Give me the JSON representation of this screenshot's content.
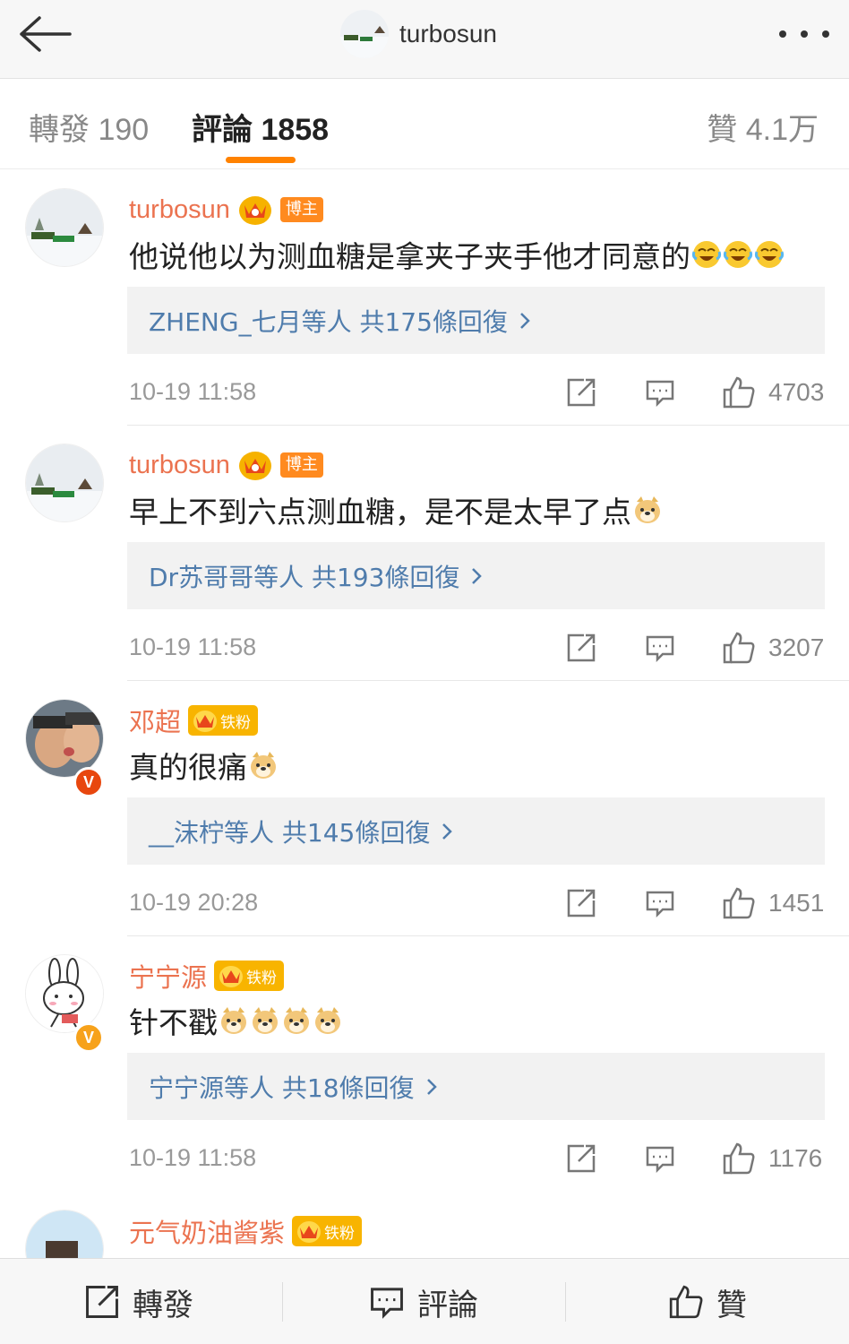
{
  "header": {
    "title": "turbosun",
    "back_icon": "arrow-left-icon",
    "more_icon": "more-dots-icon"
  },
  "tabs": {
    "repost": "轉發 190",
    "comments": "評論 1858",
    "likes": "贊 4.1万",
    "active": "comments",
    "accent_color": "#ff8200"
  },
  "comments": [
    {
      "username": "turbosun",
      "badge": "博主",
      "text": "他说他以为测血糖是拿夹子夹手他才同意的",
      "emoji": [
        "laugh-cry-emoji",
        "laugh-cry-emoji",
        "laugh-cry-emoji"
      ],
      "reply_summary": "ZHENG_七月等人 共175條回復",
      "time": "10-19 11:58",
      "likes": "4703"
    },
    {
      "username": "turbosun",
      "badge": "博主",
      "text": "早上不到六点测血糖，是不是太早了点",
      "emoji": [
        "doge-emoji"
      ],
      "reply_summary": "Dr苏哥哥等人 共193條回復",
      "time": "10-19 11:58",
      "likes": "3207"
    },
    {
      "username": "邓超",
      "badge": "铁粉",
      "text": "真的很痛",
      "emoji": [
        "doge-emoji"
      ],
      "reply_summary": "__沫柠等人 共145條回復",
      "time": "10-19 20:28",
      "likes": "1451"
    },
    {
      "username": "宁宁源",
      "badge": "铁粉",
      "text": "针不戳",
      "emoji": [
        "doge-emoji",
        "doge-emoji",
        "doge-emoji",
        "doge-emoji"
      ],
      "reply_summary": "宁宁源等人 共18條回復",
      "time": "10-19 11:58",
      "likes": "1176"
    },
    {
      "username": "元气奶油酱紫",
      "badge": "铁粉"
    }
  ],
  "bottom_bar": {
    "repost": "轉發",
    "comment": "評論",
    "like": "贊"
  },
  "colors": {
    "username": "#eb7350",
    "link": "#4f7cac",
    "badge_orange": "#ff8a1f",
    "fan_badge": "#f8b400"
  }
}
